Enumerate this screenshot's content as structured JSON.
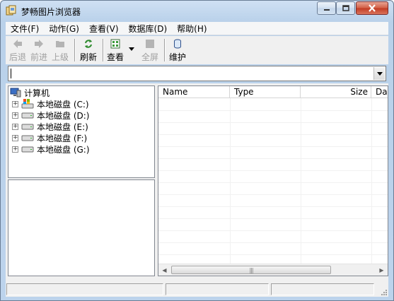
{
  "window": {
    "title": "梦畅图片浏览器",
    "min_icon": "minimize-icon",
    "max_icon": "maximize-icon",
    "close_icon": "close-icon"
  },
  "menu": {
    "items": [
      {
        "label": "文件(F)"
      },
      {
        "label": "动作(G)"
      },
      {
        "label": "查看(V)"
      },
      {
        "label": "数据库(D)"
      },
      {
        "label": "帮助(H)"
      }
    ]
  },
  "toolbar": {
    "back": {
      "label": "后退",
      "icon": "arrow-left-icon",
      "enabled": false
    },
    "forward": {
      "label": "前进",
      "icon": "arrow-right-icon",
      "enabled": false
    },
    "up": {
      "label": "上级",
      "icon": "folder-up-icon",
      "enabled": false
    },
    "refresh": {
      "label": "刷新",
      "icon": "refresh-icon",
      "enabled": true
    },
    "view": {
      "label": "查看",
      "icon": "view-grid-icon",
      "enabled": true
    },
    "fullscreen": {
      "label": "全屏",
      "icon": "fullscreen-icon",
      "enabled": false
    },
    "maintain": {
      "label": "维护",
      "icon": "database-icon",
      "enabled": true
    }
  },
  "address": {
    "value": ""
  },
  "tree": {
    "root": {
      "label": "计算机",
      "icon": "computer-icon"
    },
    "drives": [
      {
        "label": "本地磁盘 (C:)",
        "icon": "system-drive-icon"
      },
      {
        "label": "本地磁盘 (D:)",
        "icon": "drive-icon"
      },
      {
        "label": "本地磁盘 (E:)",
        "icon": "drive-icon"
      },
      {
        "label": "本地磁盘 (F:)",
        "icon": "drive-icon"
      },
      {
        "label": "本地磁盘 (G:)",
        "icon": "drive-icon"
      }
    ]
  },
  "filelist": {
    "columns": [
      {
        "label": "Name"
      },
      {
        "label": "Type"
      },
      {
        "label": "Size"
      },
      {
        "label": "Da"
      }
    ],
    "rows": []
  },
  "colors": {
    "titlebar": "#bcd3ec",
    "close_button": "#c23b22",
    "toolbar_bg": "#f0f0f0"
  }
}
